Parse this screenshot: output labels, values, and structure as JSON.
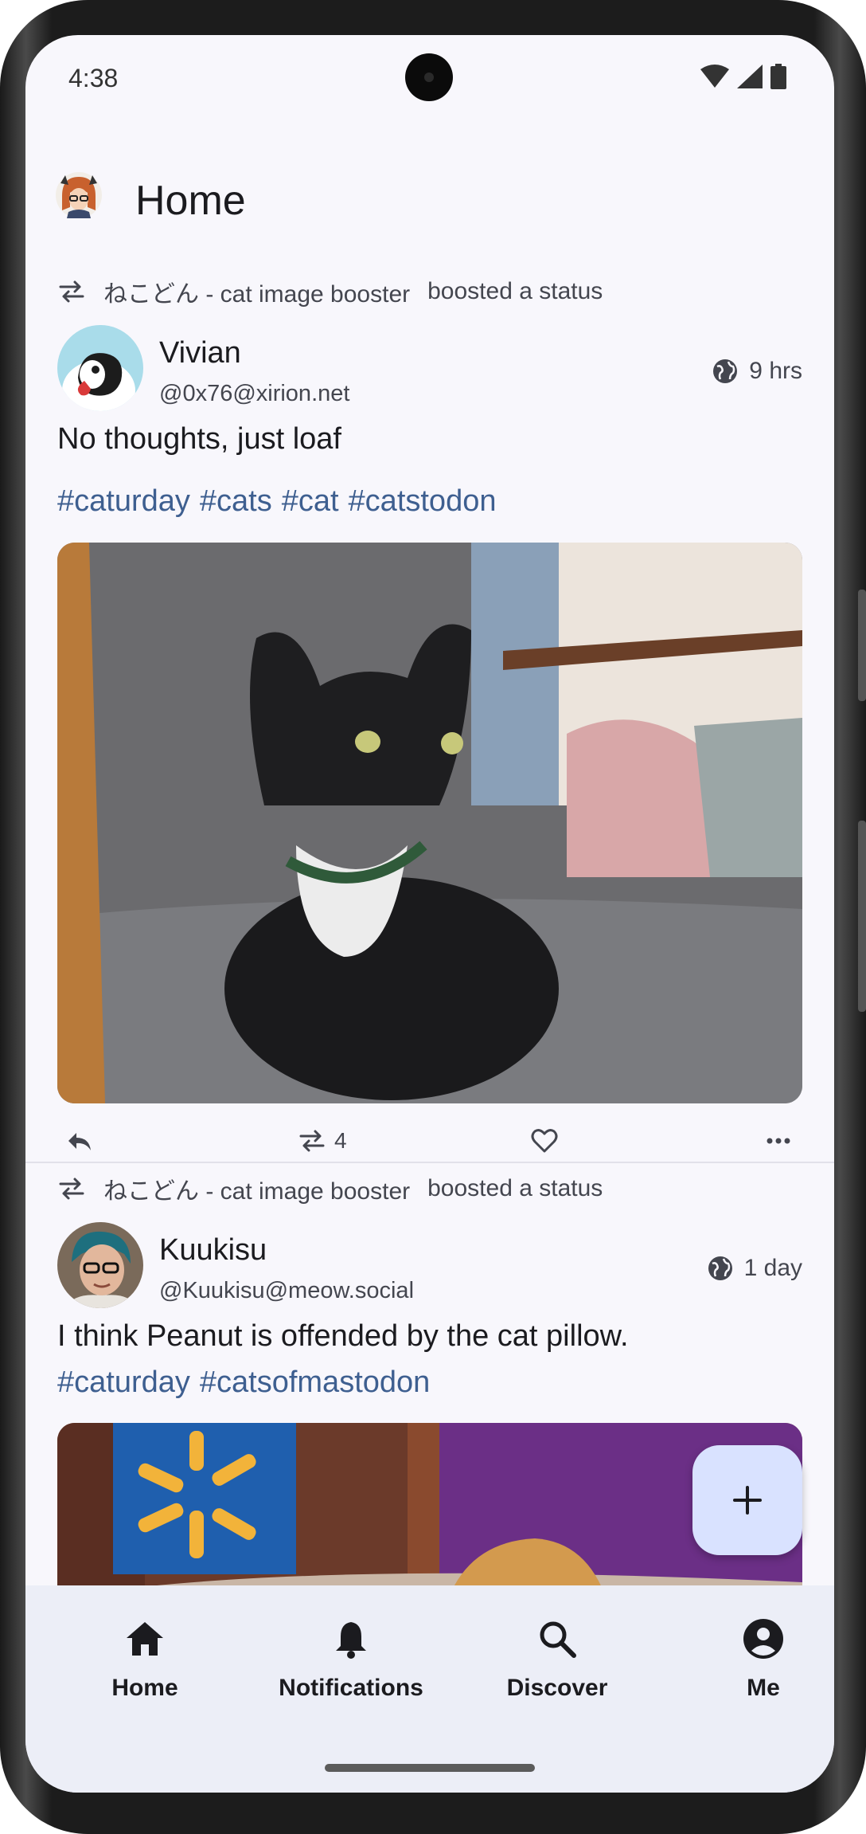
{
  "status_bar": {
    "time": "4:38"
  },
  "header": {
    "title": "Home"
  },
  "posts": [
    {
      "booster": "ねこどん - cat image booster",
      "boost_action": "boosted a status",
      "author": "Vivian",
      "handle": "@0x76@xirion.net",
      "time": "9 hrs",
      "text": "No thoughts, just loaf",
      "hashtags": [
        "#caturday",
        "#cats",
        "#cat",
        "#catstodon"
      ],
      "boost_count": "4"
    },
    {
      "booster": "ねこどん - cat image booster",
      "boost_action": "boosted a status",
      "author": "Kuukisu",
      "handle": "@Kuukisu@meow.social",
      "time": "1 day",
      "text": "I think Peanut is offended by the cat pillow.",
      "hashtags": [
        "#caturday",
        "#catsofmastodon"
      ]
    }
  ],
  "fab": {
    "icon": "plus-icon"
  },
  "bottom_nav": [
    {
      "label": "Home",
      "icon": "home-icon"
    },
    {
      "label": "Notifications",
      "icon": "bell-icon"
    },
    {
      "label": "Discover",
      "icon": "search-icon"
    },
    {
      "label": "Me",
      "icon": "account-icon"
    }
  ],
  "colors": {
    "link": "#3e5f90",
    "background": "#f8f7fc",
    "nav_background": "#eceef7",
    "fab": "#d9e2ff"
  }
}
